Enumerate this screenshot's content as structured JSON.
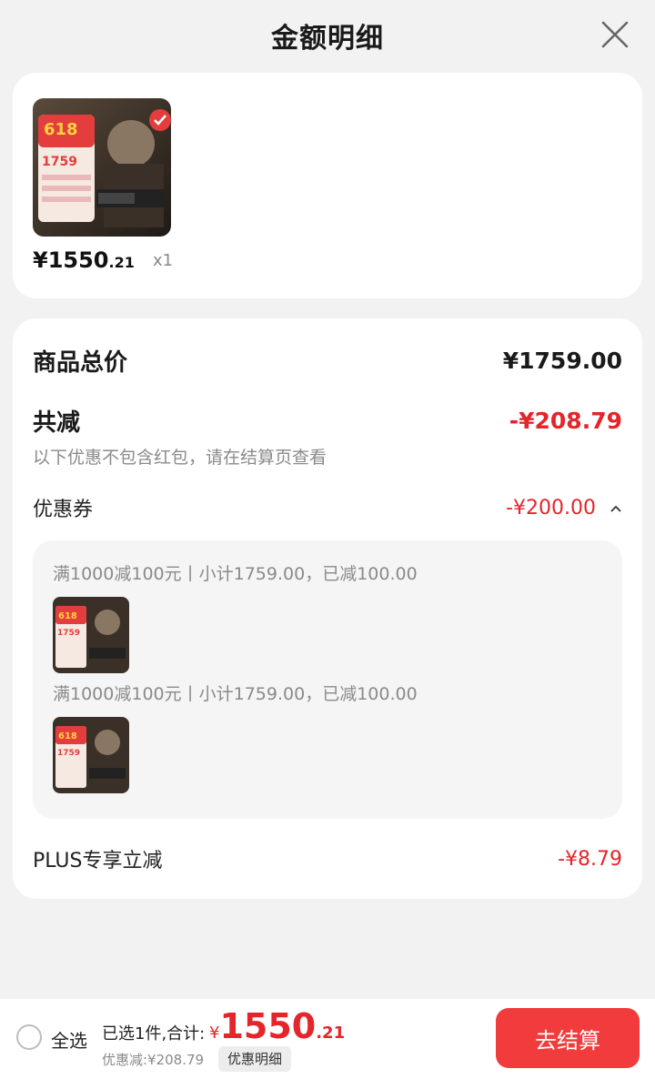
{
  "header": {
    "title": "金额明细"
  },
  "product": {
    "price_symbol": "¥",
    "price_int": "1550",
    "price_dec": ".21",
    "quantity": "x1",
    "thumb": {
      "badge": "618",
      "banner": "限时疯抢",
      "price": "1759"
    }
  },
  "details": {
    "total_label": "商品总价",
    "total_value": "¥1759.00",
    "reduce_label": "共减",
    "reduce_value": "-¥208.79",
    "hint": "以下优惠不包含红包，请在结算页查看",
    "coupon_label": "优惠券",
    "coupon_value": "-¥200.00",
    "coupons": [
      {
        "text": "满1000减100元丨小计1759.00，已减100.00"
      },
      {
        "text": "满1000减100元丨小计1759.00，已减100.00"
      }
    ],
    "plus_label": "PLUS专享立减",
    "plus_value": "-¥8.79"
  },
  "footer": {
    "select_all": "全选",
    "summary": "已选1件,合计:",
    "total_symbol": "¥",
    "total_int": "1550",
    "total_dec": ".21",
    "discount": "优惠减:¥208.79",
    "detail_link": "优惠明细",
    "checkout": "去结算"
  },
  "colors": {
    "accent_red": "#e4252b",
    "button_red": "#f23b3c"
  }
}
